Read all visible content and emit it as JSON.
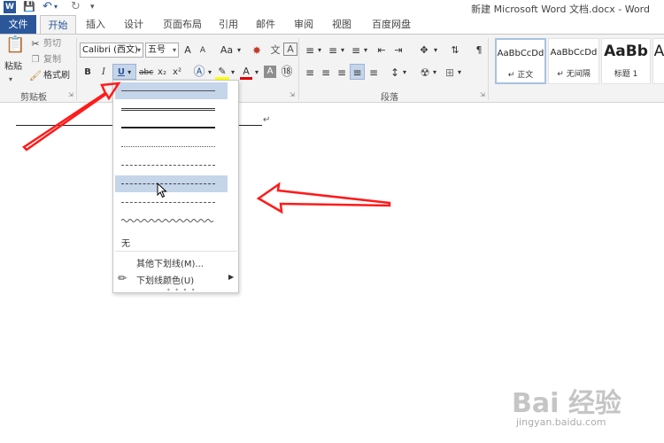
{
  "window": {
    "title": "新建 Microsoft Word 文档.docx - Word",
    "qa_icons": [
      "word-icon",
      "save-icon",
      "undo-icon",
      "redo-icon",
      "customize-qa-icon"
    ]
  },
  "tabs": [
    {
      "label": "文件"
    },
    {
      "label": "开始"
    },
    {
      "label": "插入"
    },
    {
      "label": "设计"
    },
    {
      "label": "页面布局"
    },
    {
      "label": "引用"
    },
    {
      "label": "邮件"
    },
    {
      "label": "审阅"
    },
    {
      "label": "视图"
    },
    {
      "label": "百度网盘"
    }
  ],
  "ribbon": {
    "clipboard": {
      "paste": "粘贴",
      "cut": "剪切",
      "copy": "复制",
      "format_painter": "格式刷",
      "group_label": "剪贴板"
    },
    "font": {
      "font_name": "Calibri (西文)",
      "font_size": "五号",
      "grow": "A",
      "shrink": "A",
      "case": "Aa",
      "bold": "B",
      "italic": "I",
      "underline": "U",
      "strike": "abc",
      "subscript": "x₂",
      "superscript": "x²"
    },
    "paragraph": {
      "group_label": "段落"
    },
    "styles": [
      {
        "sample": "AaBbCcDd",
        "name": "↵ 正文"
      },
      {
        "sample": "AaBbCcDd",
        "name": "↵ 无间隔"
      },
      {
        "sample": "AaBb",
        "name": "标题 1"
      },
      {
        "sample": "A",
        "name": ""
      }
    ]
  },
  "underline_menu": {
    "styles": [
      "single",
      "thick",
      "double-weight",
      "dotted",
      "dashed",
      "dash-dot",
      "dash-dot-dot",
      "wave"
    ],
    "none_label": "无",
    "more_label": "其他下划线(M)...",
    "color_label": "下划线颜色(U)",
    "highlight_index": 5
  },
  "colors": {
    "accent": "#2b579a",
    "highlight": "#c5d5ea",
    "arrow": "#ff1a1a"
  },
  "watermark": {
    "main": "Bai 经验",
    "sub": "jingyan.baidu.com"
  }
}
